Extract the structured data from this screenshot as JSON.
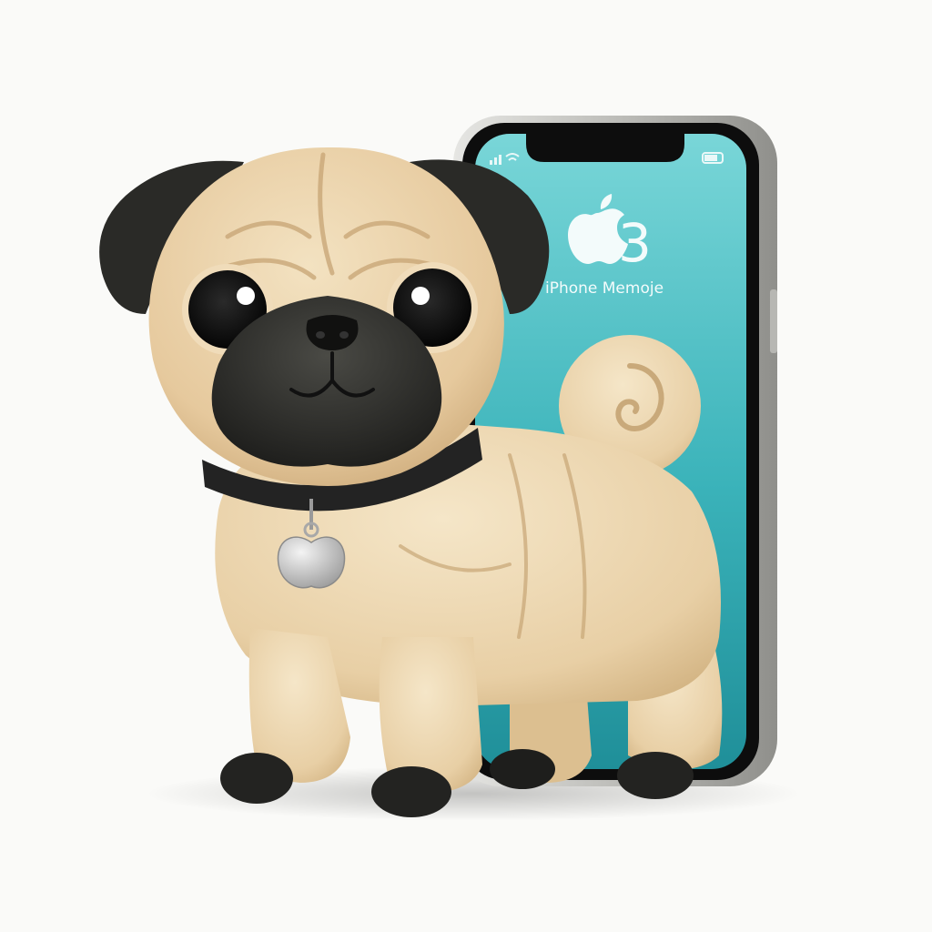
{
  "scene": {
    "background_color": "#fafaf8"
  },
  "phone": {
    "screen_number": "3",
    "screen_caption": "iPhone Memoje",
    "logo_icon": "apple-logo-icon",
    "status_icons": [
      "signal-icon",
      "wifi-icon",
      "battery-icon"
    ],
    "screen_color_top": "#6fd0d3",
    "screen_color_bottom": "#1b8f9a",
    "frame_color": "#c9c9c6"
  },
  "pug": {
    "fur_color": "#e7cda4",
    "mask_color": "#2b2b28",
    "collar_color": "#232323",
    "tag_icon": "apple-tag-icon"
  }
}
